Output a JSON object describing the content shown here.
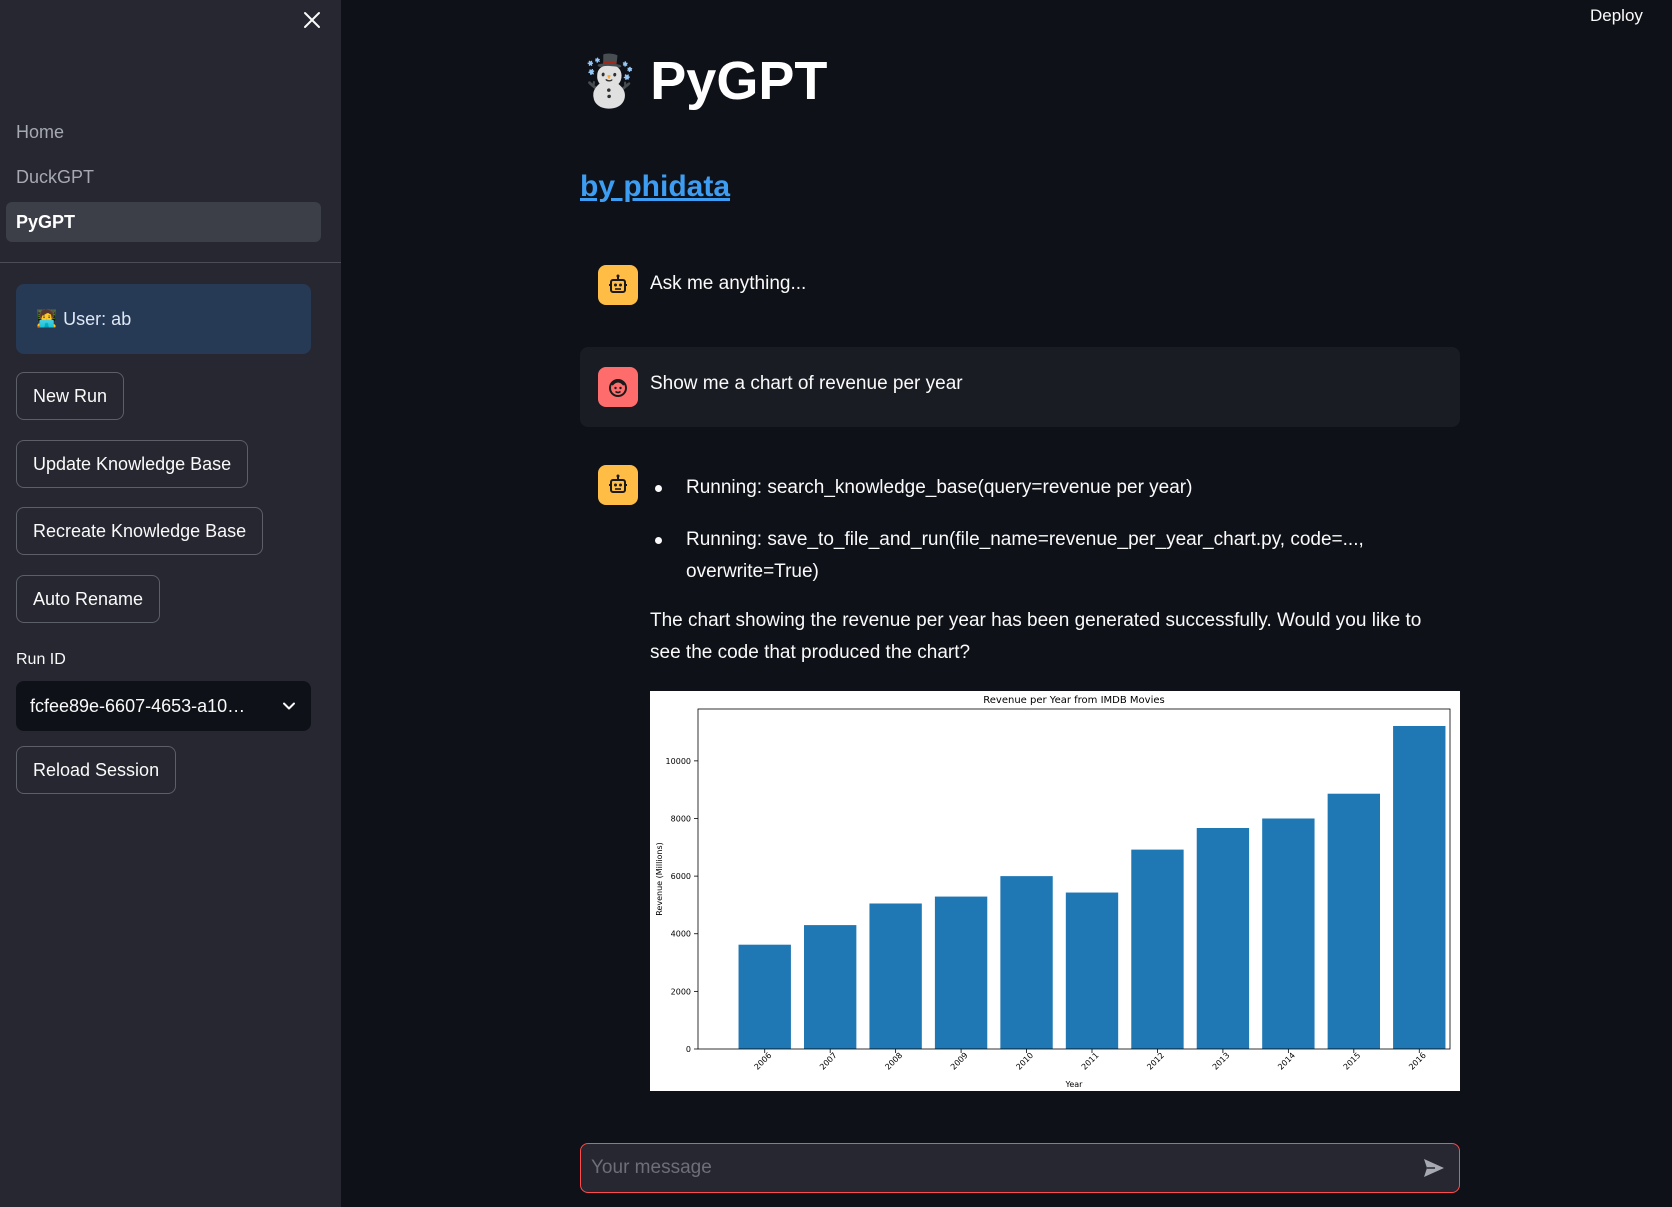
{
  "sidebar": {
    "nav": [
      {
        "label": "Home",
        "active": false
      },
      {
        "label": "DuckGPT",
        "active": false
      },
      {
        "label": "PyGPT",
        "active": true
      }
    ],
    "user": {
      "emoji": "🧑‍💻",
      "text": "User: ab"
    },
    "buttons": {
      "new_run": "New Run",
      "update_kb": "Update Knowledge Base",
      "recreate_kb": "Recreate Knowledge Base",
      "auto_rename": "Auto Rename",
      "reload_session": "Reload Session"
    },
    "run_id_label": "Run ID",
    "run_id_value": "fcfee89e-6607-4653-a10…"
  },
  "header": {
    "deploy_label": "Deploy"
  },
  "main": {
    "title_emoji": "☃️",
    "title": "PyGPT",
    "by_link": "by phidata",
    "messages": {
      "bot_greeting": "Ask me anything...",
      "user_query": "Show me a chart of revenue per year",
      "tool_calls": [
        "Running: search_knowledge_base(query=revenue per year)",
        "Running: save_to_file_and_run(file_name=revenue_per_year_chart.py, code=..., overwrite=True)"
      ],
      "reply": "The chart showing the revenue per year has been generated successfully. Would you like to see the code that produced the chart?"
    },
    "chat_input_placeholder": "Your message"
  },
  "colors": {
    "bar": "#1f77b4",
    "bot_avatar": "#ffbd45",
    "user_avatar": "#ff6c6c",
    "link": "#3d9df3",
    "input_border": "#ff4b4b"
  },
  "chart_data": {
    "type": "bar",
    "title": "Revenue per Year from IMDB Movies",
    "xlabel": "Year",
    "ylabel": "Revenue (Millions)",
    "categories": [
      "2006",
      "2007",
      "2008",
      "2009",
      "2010",
      "2011",
      "2012",
      "2013",
      "2014",
      "2015",
      "2016"
    ],
    "values": [
      3620,
      4300,
      5050,
      5290,
      6000,
      5430,
      6920,
      7670,
      8000,
      8860,
      11210
    ],
    "ylim": [
      0,
      11800
    ],
    "yticks": [
      0,
      2000,
      4000,
      6000,
      8000,
      10000
    ],
    "grid": false
  }
}
